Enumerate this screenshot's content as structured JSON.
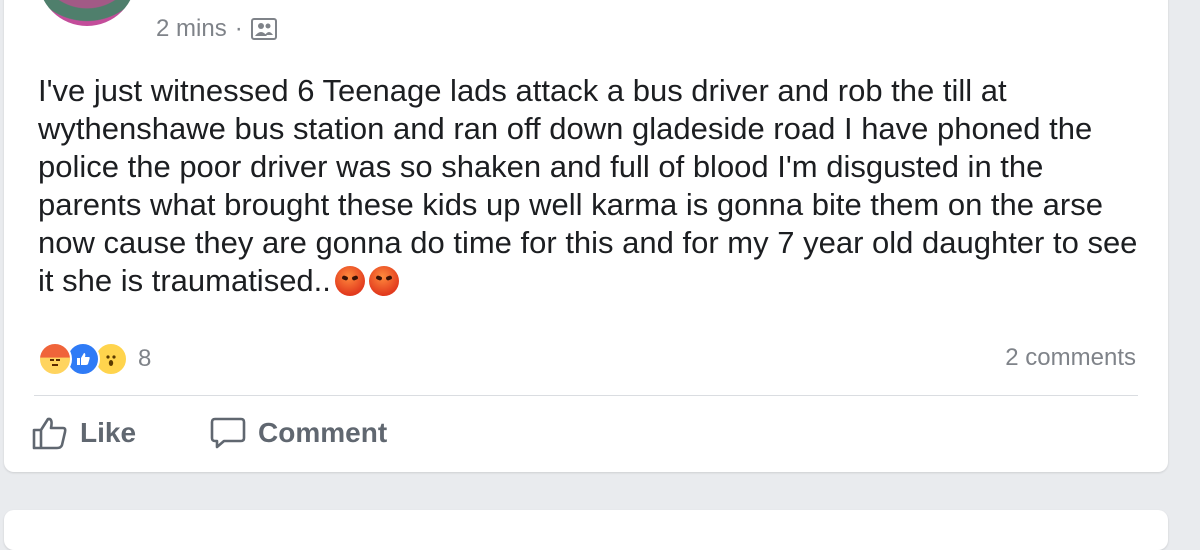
{
  "post": {
    "timestamp": "2 mins",
    "separator": "·",
    "audience_icon": "friends-icon",
    "text": "I've just witnessed 6 Teenage lads attack a bus driver and rob the till at wythenshawe bus station and ran off down gladeside road I have phoned the police the poor driver was so shaken and full of blood I'm disgusted in the parents what brought these kids up well karma is gonna bite them on the arse now cause they are gonna do time for this and for my 7 year old daughter to see it she is traumatised..",
    "trailing_emojis": [
      "angry-face-emoji",
      "angry-face-emoji"
    ]
  },
  "reactions": {
    "types": [
      "angry",
      "like",
      "wow"
    ],
    "count": "8"
  },
  "comments_label": "2 comments",
  "actions": {
    "like_label": "Like",
    "comment_label": "Comment"
  },
  "colors": {
    "background": "#e9ebee",
    "card": "#ffffff",
    "text": "#1c1e21",
    "muted": "#7f8389",
    "like_blue": "#2f7bf6",
    "angry_orange": "#f0643a"
  }
}
